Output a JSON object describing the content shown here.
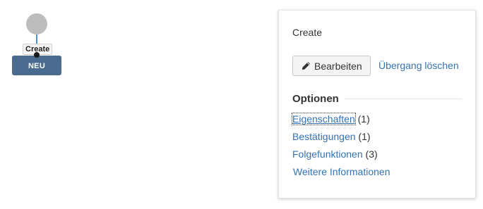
{
  "diagram": {
    "transition_label": "Create",
    "status_label": "NEU",
    "colors": {
      "start_node": "#bdbdbd",
      "connector": "#4f8fd6",
      "status_node": "#4a6a8f"
    }
  },
  "panel": {
    "title": "Create",
    "edit_button": {
      "label": "Bearbeiten",
      "icon": "pencil-icon"
    },
    "delete_link": "Übergang löschen",
    "options": {
      "heading": "Optionen",
      "items": [
        {
          "label": "Eigenschaften",
          "count": "(1)"
        },
        {
          "label": "Bestätigungen",
          "count": "(1)"
        },
        {
          "label": "Folgefunktionen",
          "count": "(3)"
        }
      ],
      "more_info": "Weitere Informationen"
    },
    "colors": {
      "link": "#3572b0"
    }
  }
}
